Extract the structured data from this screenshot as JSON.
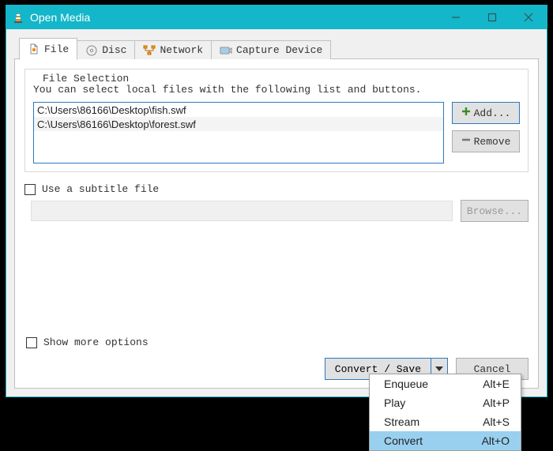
{
  "window": {
    "title": "Open Media"
  },
  "tabs": {
    "file": "File",
    "disc": "Disc",
    "network": "Network",
    "capture": "Capture Device"
  },
  "fileSelection": {
    "legend": "File Selection",
    "instruction": "You can select local files with the following list and buttons.",
    "files": [
      "C:\\Users\\86166\\Desktop\\fish.swf",
      "C:\\Users\\86166\\Desktop\\forest.swf"
    ],
    "addLabel": "Add...",
    "removeLabel": "Remove"
  },
  "subtitle": {
    "checkboxLabel": "Use a subtitle file",
    "browseLabel": "Browse..."
  },
  "moreOptionsLabel": "Show more options",
  "actions": {
    "convertSave": "Convert / Save",
    "cancel": "Cancel"
  },
  "menu": {
    "items": [
      {
        "label": "Enqueue",
        "shortcut": "Alt+E"
      },
      {
        "label": "Play",
        "shortcut": "Alt+P"
      },
      {
        "label": "Stream",
        "shortcut": "Alt+S"
      },
      {
        "label": "Convert",
        "shortcut": "Alt+O"
      }
    ],
    "highlightIndex": 3
  }
}
